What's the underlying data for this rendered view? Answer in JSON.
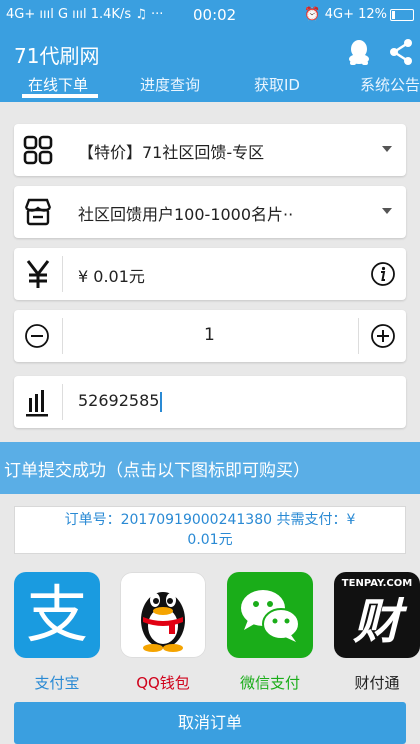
{
  "statusbar": {
    "left": "4G+ ıııl G ıııl 1.4K/s ♫ ···",
    "time": "00:02",
    "right": "⏰ 4G+ 12%"
  },
  "app": {
    "title": "71代刷网",
    "tabs": [
      {
        "label": "在线下单"
      },
      {
        "label": "进度查询"
      },
      {
        "label": "获取ID"
      },
      {
        "label": "系统公告"
      }
    ]
  },
  "form": {
    "category": "【特价】71社区回馈-专区",
    "product": "社区回馈用户100-1000名片··",
    "price": "¥ 0.01元",
    "quantity": "1",
    "account": "52692585"
  },
  "result": {
    "banner": "订单提交成功（点击以下图标即可购买）",
    "order_line1": "订单号：20170919000241380  共需支付：¥",
    "order_line2": "0.01元"
  },
  "payments": [
    {
      "label": "支付宝",
      "color": "#2a8ad4"
    },
    {
      "label": "QQ钱包",
      "color": "#d0021b"
    },
    {
      "label": "微信支付",
      "color": "#1aad19"
    },
    {
      "label": "财付通",
      "color": "#222222"
    }
  ],
  "icons": {
    "alipay_glyph": "支",
    "tenpay_glyph": "财",
    "tenpay_brand": "TENPAY.COM"
  },
  "cancel_label": "取消订单"
}
